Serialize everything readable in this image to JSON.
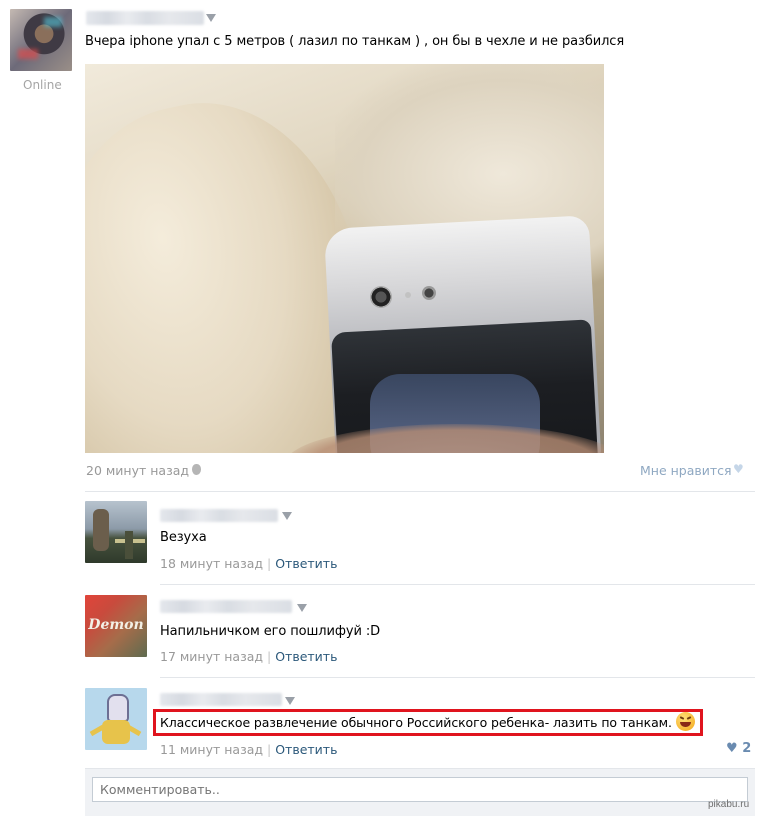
{
  "post": {
    "author_status": "Online",
    "text": "Вчера iphone упал с 5 метров ( лазил по танкам ) , он бы в чехле и не разбился",
    "time": "20 минут назад",
    "like_label": "Мне нравится"
  },
  "comments": [
    {
      "avatar_text": "",
      "text": "Везуха",
      "time": "18 минут назад",
      "reply": "Ответить"
    },
    {
      "avatar_text": "Demon",
      "text": "Напильничком его пошлифуй :D",
      "time": "17 минут назад",
      "reply": "Ответить"
    },
    {
      "avatar_text": "",
      "text": "Классическое развлечение обычного Российского ребенка- лазить по танкам.",
      "time": "11 минут назад",
      "reply": "Ответить",
      "likes": "2"
    }
  ],
  "comment_input": {
    "placeholder": "Комментировать.."
  },
  "watermark": "pikabu.ru",
  "colors": {
    "link": "#2b587a",
    "meta": "#999999",
    "highlight": "#e0141e",
    "like_heart": "#c5d6e8"
  }
}
